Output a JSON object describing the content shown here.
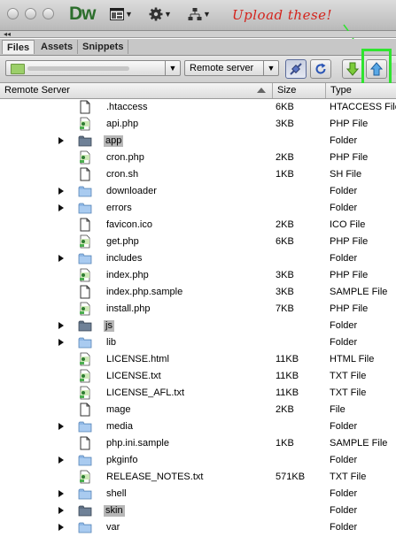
{
  "app": {
    "logo": "Dw"
  },
  "annotation": "Upload these!",
  "tabs": [
    {
      "label": "Files",
      "active": true
    },
    {
      "label": "Assets",
      "active": false
    },
    {
      "label": "Snippets",
      "active": false
    }
  ],
  "toolbar": {
    "site_select_value": "",
    "view_select_value": "Remote server"
  },
  "columns": {
    "name": "Remote Server",
    "size": "Size",
    "type": "Type"
  },
  "colors": {
    "upload_highlight": "#2fe42f",
    "annotation": "#d4231c",
    "folder": "#8fb8e6",
    "folder_selected": "#5d6e82"
  },
  "files": [
    {
      "name": ".htaccess",
      "size": "6KB",
      "type": "HTACCESS File",
      "kind": "doc",
      "expandable": false,
      "selected": false
    },
    {
      "name": "api.php",
      "size": "3KB",
      "type": "PHP File",
      "kind": "php",
      "expandable": false,
      "selected": false
    },
    {
      "name": "app",
      "size": "",
      "type": "Folder",
      "kind": "folder",
      "expandable": true,
      "selected": true
    },
    {
      "name": "cron.php",
      "size": "2KB",
      "type": "PHP File",
      "kind": "php",
      "expandable": false,
      "selected": false
    },
    {
      "name": "cron.sh",
      "size": "1KB",
      "type": "SH File",
      "kind": "doc",
      "expandable": false,
      "selected": false
    },
    {
      "name": "downloader",
      "size": "",
      "type": "Folder",
      "kind": "folder",
      "expandable": true,
      "selected": false
    },
    {
      "name": "errors",
      "size": "",
      "type": "Folder",
      "kind": "folder",
      "expandable": true,
      "selected": false
    },
    {
      "name": "favicon.ico",
      "size": "2KB",
      "type": "ICO File",
      "kind": "doc",
      "expandable": false,
      "selected": false
    },
    {
      "name": "get.php",
      "size": "6KB",
      "type": "PHP File",
      "kind": "php",
      "expandable": false,
      "selected": false
    },
    {
      "name": "includes",
      "size": "",
      "type": "Folder",
      "kind": "folder",
      "expandable": true,
      "selected": false
    },
    {
      "name": "index.php",
      "size": "3KB",
      "type": "PHP File",
      "kind": "php",
      "expandable": false,
      "selected": false
    },
    {
      "name": "index.php.sample",
      "size": "3KB",
      "type": "SAMPLE File",
      "kind": "doc",
      "expandable": false,
      "selected": false
    },
    {
      "name": "install.php",
      "size": "7KB",
      "type": "PHP File",
      "kind": "php",
      "expandable": false,
      "selected": false
    },
    {
      "name": "js",
      "size": "",
      "type": "Folder",
      "kind": "folder",
      "expandable": true,
      "selected": true
    },
    {
      "name": "lib",
      "size": "",
      "type": "Folder",
      "kind": "folder",
      "expandable": true,
      "selected": false
    },
    {
      "name": "LICENSE.html",
      "size": "11KB",
      "type": "HTML File",
      "kind": "php",
      "expandable": false,
      "selected": false
    },
    {
      "name": "LICENSE.txt",
      "size": "11KB",
      "type": "TXT File",
      "kind": "php",
      "expandable": false,
      "selected": false
    },
    {
      "name": "LICENSE_AFL.txt",
      "size": "11KB",
      "type": "TXT File",
      "kind": "php",
      "expandable": false,
      "selected": false
    },
    {
      "name": "mage",
      "size": "2KB",
      "type": "File",
      "kind": "doc",
      "expandable": false,
      "selected": false
    },
    {
      "name": "media",
      "size": "",
      "type": "Folder",
      "kind": "folder",
      "expandable": true,
      "selected": false
    },
    {
      "name": "php.ini.sample",
      "size": "1KB",
      "type": "SAMPLE File",
      "kind": "doc",
      "expandable": false,
      "selected": false
    },
    {
      "name": "pkginfo",
      "size": "",
      "type": "Folder",
      "kind": "folder",
      "expandable": true,
      "selected": false
    },
    {
      "name": "RELEASE_NOTES.txt",
      "size": "571KB",
      "type": "TXT File",
      "kind": "php",
      "expandable": false,
      "selected": false
    },
    {
      "name": "shell",
      "size": "",
      "type": "Folder",
      "kind": "folder",
      "expandable": true,
      "selected": false
    },
    {
      "name": "skin",
      "size": "",
      "type": "Folder",
      "kind": "folder",
      "expandable": true,
      "selected": true
    },
    {
      "name": "var",
      "size": "",
      "type": "Folder",
      "kind": "folder",
      "expandable": true,
      "selected": false
    }
  ]
}
